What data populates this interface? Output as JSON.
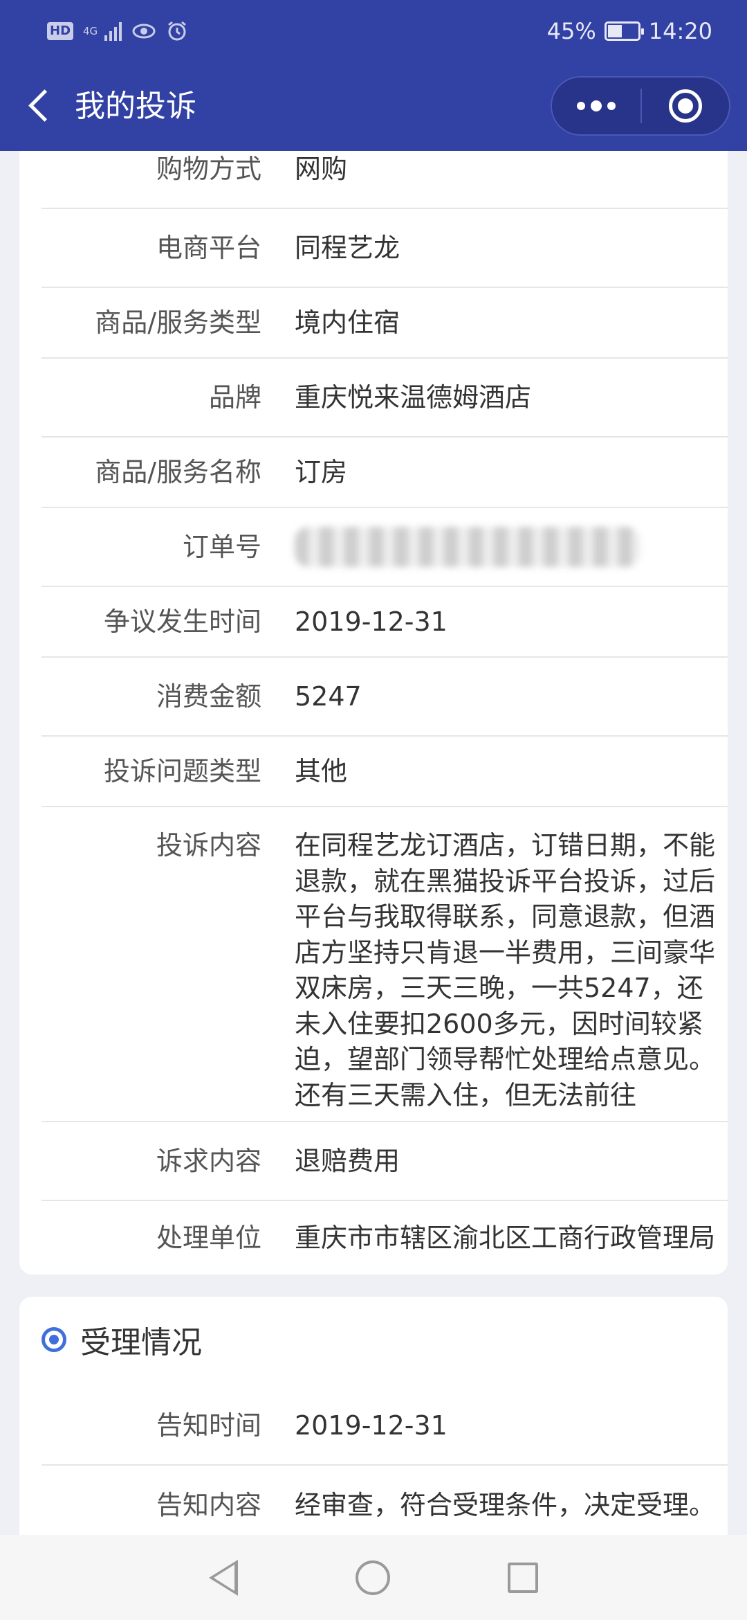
{
  "status_bar": {
    "hd": "HD",
    "network": "4G",
    "battery": "45%",
    "time": "14:20"
  },
  "nav": {
    "title": "我的投诉",
    "back_icon": "chevron-left-icon",
    "more_icon": "more-dots-icon",
    "close_icon": "target-close-icon"
  },
  "details": [
    {
      "label": "购物方式",
      "value": "网购"
    },
    {
      "label": "电商平台",
      "value": "同程艺龙"
    },
    {
      "label": "商品/服务类型",
      "value": "境内住宿"
    },
    {
      "label": "品牌",
      "value": "重庆悦来温德姆酒店"
    },
    {
      "label": "商品/服务名称",
      "value": "订房"
    },
    {
      "label": "订单号",
      "value": ""
    },
    {
      "label": "争议发生时间",
      "value": "2019-12-31"
    },
    {
      "label": "消费金额",
      "value": "5247"
    },
    {
      "label": "投诉问题类型",
      "value": "其他"
    },
    {
      "label": "投诉内容",
      "value": "在同程艺龙订酒店，订错日期，不能退款，就在黑猫投诉平台投诉，过后平台与我取得联系，同意退款，但酒店方坚持只肯退一半费用，三间豪华双床房，三天三晚，一共5247，还未入住要扣2600多元，因时间较紧迫，望部门领导帮忙处理给点意见。还有三天需入住，但无法前往"
    },
    {
      "label": "诉求内容",
      "value": "退赔费用"
    },
    {
      "label": "处理单位",
      "value": "重庆市市辖区渝北区工商行政管理局"
    }
  ],
  "acceptance": {
    "title": "受理情况",
    "rows": [
      {
        "label": "告知时间",
        "value": "2019-12-31"
      },
      {
        "label": "告知内容",
        "value": "经审查，符合受理条件，决定受理。"
      }
    ]
  },
  "colors": {
    "header": "#3241a4",
    "accent": "#3f6fd8"
  }
}
